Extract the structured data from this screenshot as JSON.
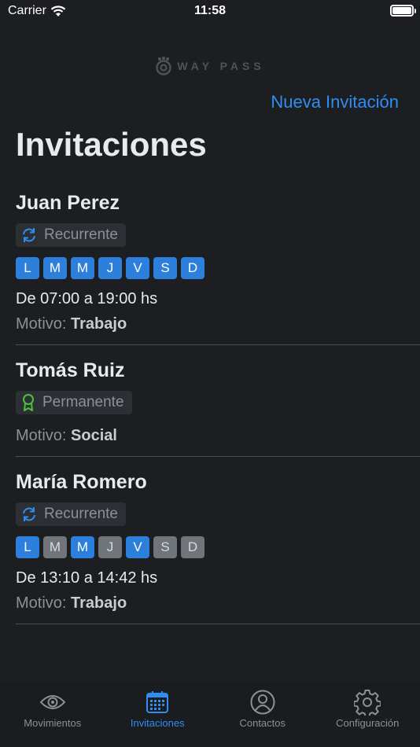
{
  "status": {
    "carrier": "Carrier",
    "time": "11:58"
  },
  "brand": {
    "name": "WAY PASS"
  },
  "header": {
    "new_invite": "Nueva Invitación",
    "title": "Invitaciones"
  },
  "colors": {
    "accent": "#2f8ef0",
    "day_on": "#2d7fdc",
    "day_off": "#70757c",
    "permanent_icon": "#4cc23a"
  },
  "reason_label": "Motivo:",
  "invitations": [
    {
      "name": "Juan Perez",
      "type": "Recurrente",
      "type_icon": "recurring-arrows-icon",
      "days": [
        {
          "letter": "L",
          "active": true
        },
        {
          "letter": "M",
          "active": true
        },
        {
          "letter": "M",
          "active": true
        },
        {
          "letter": "J",
          "active": true
        },
        {
          "letter": "V",
          "active": true
        },
        {
          "letter": "S",
          "active": true
        },
        {
          "letter": "D",
          "active": true
        }
      ],
      "schedule": "De 07:00 a 19:00 hs",
      "reason": "Trabajo"
    },
    {
      "name": "Tomás Ruiz",
      "type": "Permanente",
      "type_icon": "award-ribbon-icon",
      "reason": "Social"
    },
    {
      "name": "María Romero",
      "type": "Recurrente",
      "type_icon": "recurring-arrows-icon",
      "days": [
        {
          "letter": "L",
          "active": true
        },
        {
          "letter": "M",
          "active": false
        },
        {
          "letter": "M",
          "active": true
        },
        {
          "letter": "J",
          "active": false
        },
        {
          "letter": "V",
          "active": true
        },
        {
          "letter": "S",
          "active": false
        },
        {
          "letter": "D",
          "active": false
        }
      ],
      "schedule": "De 13:10 a 14:42 hs",
      "reason": "Trabajo"
    }
  ],
  "tabs": [
    {
      "label": "Movimientos",
      "icon": "eye-icon",
      "active": false
    },
    {
      "label": "Invitaciones",
      "icon": "calendar-icon",
      "active": true
    },
    {
      "label": "Contactos",
      "icon": "contact-person-icon",
      "active": false
    },
    {
      "label": "Configuración",
      "icon": "gear-icon",
      "active": false
    }
  ]
}
